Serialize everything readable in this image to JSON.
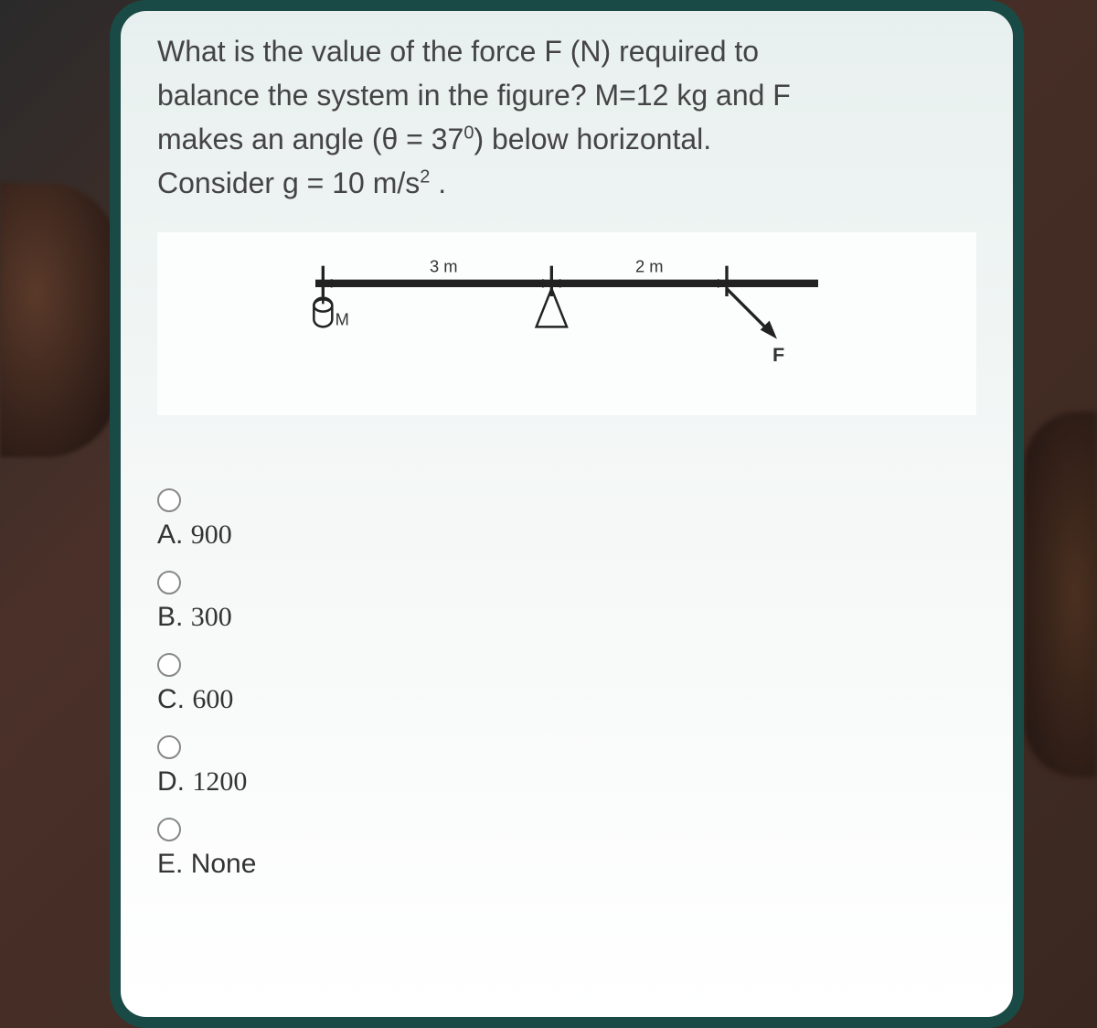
{
  "question": {
    "line1": "What is the value of the force F (N) required to",
    "line2": "balance the system in the figure? M=12 kg and F",
    "line3_a": "makes an angle (θ = 37",
    "line3_sup": "0",
    "line3_b": ") below horizontal.",
    "line4_a": "Consider g = 10 m/s",
    "line4_sup": "2",
    "line4_b": " ."
  },
  "figure": {
    "dist_left": "3 m",
    "dist_right": "2 m",
    "mass_label": "M",
    "force_label": "F"
  },
  "options": [
    {
      "letter": "A.",
      "value": "900"
    },
    {
      "letter": "B.",
      "value": "300"
    },
    {
      "letter": "C.",
      "value": "600"
    },
    {
      "letter": "D.",
      "value": "1200"
    },
    {
      "letter": "E.",
      "value": "None"
    }
  ]
}
